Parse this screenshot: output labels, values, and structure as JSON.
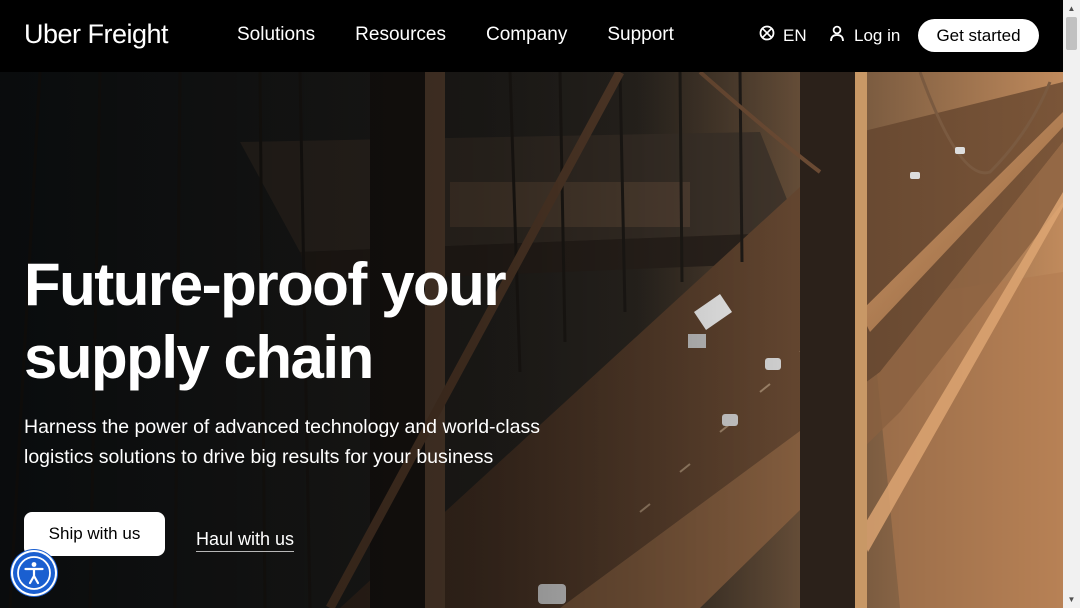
{
  "nav": {
    "logo": "Uber Freight",
    "links": [
      {
        "label": "Solutions"
      },
      {
        "label": "Resources"
      },
      {
        "label": "Company"
      },
      {
        "label": "Support"
      }
    ],
    "language": "EN",
    "login": "Log in",
    "cta": "Get started"
  },
  "hero": {
    "headline": "Future-proof your supply chain",
    "subhead": "Harness the power of advanced technology and world-class logistics solutions to drive big results for your business",
    "primary_button": "Ship with us",
    "secondary_link": "Haul with us"
  },
  "icons": {
    "language": "globe-icon",
    "login": "person-icon",
    "accessibility": "accessibility-icon"
  },
  "colors": {
    "nav_background": "#000000",
    "accessibility_button": "#1a5fd0",
    "button_background": "#ffffff"
  }
}
